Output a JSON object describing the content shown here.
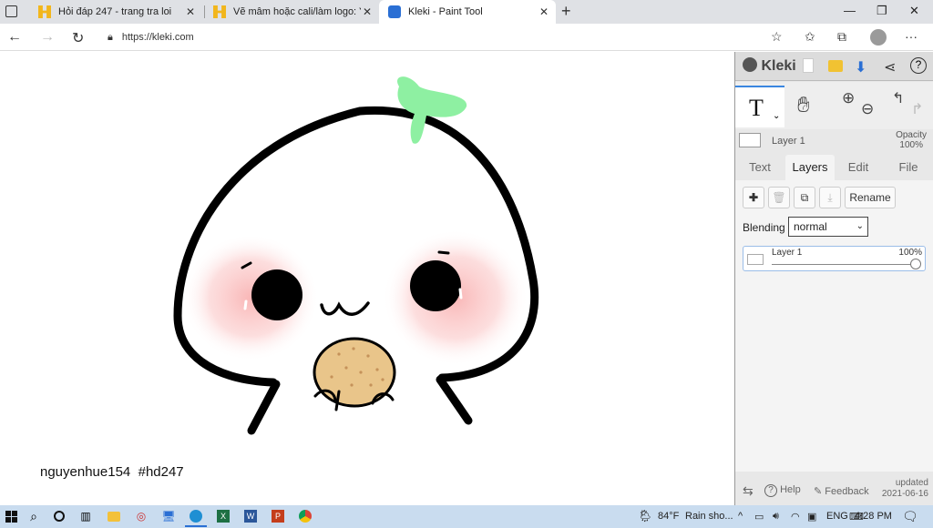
{
  "browser": {
    "tabs": [
      {
        "title": "Hỏi đáp 247 - trang tra loi"
      },
      {
        "title": "Vẽ mâm hoặc cali/làm logo: Yêu"
      },
      {
        "title": "Kleki - Paint Tool"
      }
    ],
    "url": "https://kleki.com"
  },
  "canvas": {
    "signature": "nguyenhue154  #hd247"
  },
  "kleki": {
    "logo": "Kleki",
    "active_layer_name": "Layer 1",
    "opacity_label": "Opacity",
    "opacity_value": "100%",
    "tabs": [
      "Text",
      "Layers",
      "Edit",
      "File"
    ],
    "rename_label": "Rename",
    "blending_label": "Blending",
    "blending_value": "normal",
    "layer_item": {
      "name": "Layer 1",
      "opacity": "100%"
    },
    "help_label": "Help",
    "feedback_label": "Feedback",
    "updated_label": "updated",
    "updated_date": "2021-06-16"
  },
  "taskbar": {
    "weather_temp": "84°F",
    "weather_text": "Rain sho...",
    "language": "ENG",
    "time": "4:28 PM"
  }
}
